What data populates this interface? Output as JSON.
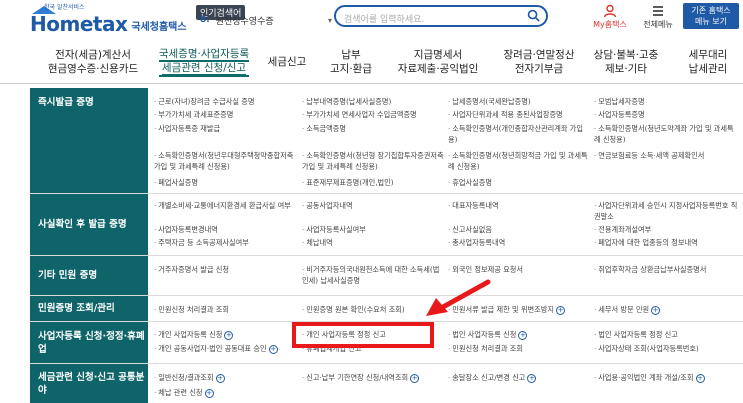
{
  "header": {
    "logo_tagline": "한국 알찬서비스",
    "logo_main": "Hometax",
    "logo_sub": "국세청홈택스",
    "popular_label": "인기검색어",
    "popular_num": "8.",
    "popular_term": "원천징수영수증",
    "search_placeholder": "검색어를 입력하세요.",
    "my_hometax": "My홈택스",
    "all_menu": "전체메뉴",
    "basic_btn_line1": "기존 홈택스",
    "basic_btn_line2": "메뉴 보기"
  },
  "nav": [
    {
      "line1": "전자(세금)계산서",
      "line2": "현금영수증·신용카드"
    },
    {
      "line1": "국세증명·사업자등록",
      "line2": "세금관련 신청/신고"
    },
    {
      "line1": "세금신고",
      "line2": ""
    },
    {
      "line1": "납부",
      "line2": "고지·환급"
    },
    {
      "line1": "지급명세서",
      "line2": "자료제출·공익법인"
    },
    {
      "line1": "장려금·연말정산",
      "line2": "전자기부금"
    },
    {
      "line1": "상담·불복·고충",
      "line2": "제보·기타"
    },
    {
      "line1": "세무대리",
      "line2": "납세관리"
    }
  ],
  "rows": [
    {
      "category": "즉시발급 증명",
      "cells": [
        "근로(자녀)장려금 수급사실 증명",
        "납부내역증명(납세사실증명)",
        "납세증명서(국세완납증명)",
        "모범납세자증명",
        "부가가치세 과세표준증명",
        "부가가치세 면세사업자 수입금액증명",
        "사업자단위과세 적용 종된사업장증명",
        "사업자등록증명",
        "사업자등록증 재발급",
        "소득금액증명",
        "소득확인증명서(개인종합자산관리계좌 가입용)",
        "소득확인증명서(청년도약계좌 가입 및 과세특례 신청용)",
        "소득확인증명서(청년우대형주택청약종합저축 가입 및 과세특례 신청용)",
        "소득확인증명서(청년형 장기집합투자증권저축 가입 및 과세특례 신청용)",
        "소득확인증명서(청년희망적금 가입 및 과세특례 신청용)",
        "연금보험료등 소득·세액 공제확인서",
        "폐업사실증명",
        "표준재무제표증명(개인,법인)",
        "휴업사실증명"
      ]
    },
    {
      "category": "사실확인 후 발급 증명",
      "cells": [
        "개별소비세·교통에너지환경세 환급사실 여부",
        "공동사업자내역",
        "대표자등록내역",
        "사업자단위과세 승인시 지정사업자등록번호 직권말소",
        "사업자등록변경내역",
        "사업자등록사실여부",
        "신고사실없음",
        "전용계좌개설여부",
        "주택자금 등 소득공제사실여부",
        "체납내역",
        "총사업자등록내역",
        "폐업자에 대한 업종등의 정보내역"
      ]
    },
    {
      "category": "기타 민원 증명",
      "cells": [
        "거주자증명서 발급 신청",
        "비거주자등의국내원천소득에 대한 소득세(법인세) 납세사실증명",
        "외국인 정보제공 요청서",
        "취업후학자금 상환금납부사실증명서"
      ]
    },
    {
      "category": "민원증명 조회/관리",
      "cells": [
        "민원신청 처리결과 조회",
        "민원증명 원본 확인(수요처 조회)",
        "민원서류 발급 제한 및 위변조방지",
        "세무서 방문 민원"
      ]
    },
    {
      "category": "사업자등록 신청·정정·휴폐업",
      "cells": [
        "개인 사업자등록 신청",
        "개인 사업자등록 정정 신고",
        "법인 사업자등록 신청",
        "법인 사업자등록 정정 신고",
        "개인 공동사업자·법인 공동대표 승인",
        "휴폐업재개업 신고",
        "민원신청 처리결과 조회",
        "사업자상태 조회(사업자등록번호)"
      ]
    },
    {
      "category": "세금관련 신청·신고 공통분야",
      "cells": [
        "일반신청/결과조회",
        "신고·납부 기한연장 신청/내역조회",
        "송달장소 신고/변경 신고",
        "사업용·공익법인 계좌 개설/조회",
        "체납 관련 신청"
      ]
    }
  ],
  "colors": {
    "brand": "#1f5aa6",
    "category_bg": "#0e6468",
    "highlight": "#e8181b"
  }
}
